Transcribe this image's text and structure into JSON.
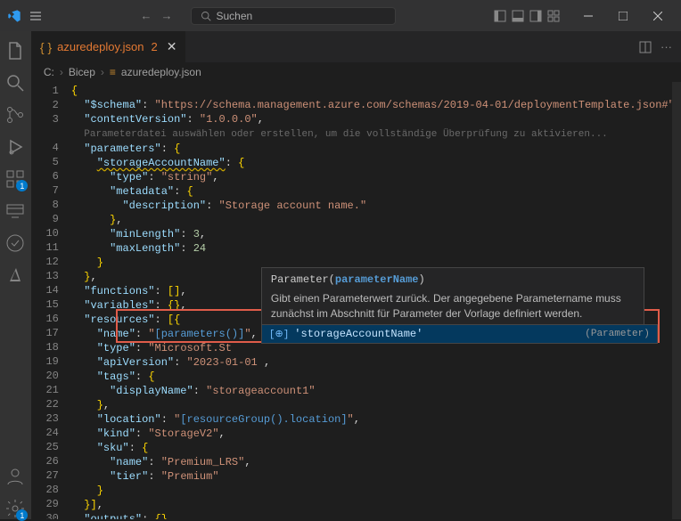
{
  "titlebar": {
    "search_placeholder": "Suchen"
  },
  "tab": {
    "name": "azuredeploy.json",
    "modified": "2"
  },
  "breadcrumb": {
    "folder": "C:",
    "sub": "Bicep",
    "file": "azuredeploy.json"
  },
  "activityBadges": {
    "extensions": "1",
    "settings": "1"
  },
  "tooltip": {
    "sig_prefix": "Parameter(",
    "sig_param": "parameterName",
    "sig_suffix": ")",
    "desc": "Gibt einen Parameterwert zurück. Der angegebene Parametername muss zunächst im Abschnitt für Parameter der Vorlage definiert werden."
  },
  "suggest": {
    "name": "'storageAccountName'",
    "kind": "(Parameter)"
  },
  "code": {
    "hint": "Parameterdatei auswählen oder erstellen, um die vollständige Überprüfung zu aktivieren...",
    "schema_key": "$schema",
    "schema_val": "https://schema.management.azure.com/schemas/2019-04-01/deploymentTemplate.json#",
    "contentVersion_key": "contentVersion",
    "contentVersion_val": "1.0.0.0",
    "parameters_key": "parameters",
    "storageAccountName_key": "storageAccountName",
    "type_key": "type",
    "type_val": "string",
    "metadata_key": "metadata",
    "description_key": "description",
    "description_val": "Storage account name.",
    "minLength_key": "minLength",
    "minLength_val": "3",
    "maxLength_key": "maxLength",
    "maxLength_val": "24",
    "functions_key": "functions",
    "variables_key": "variables",
    "resources_key": "resources",
    "name_key": "name",
    "name_expr": "[parameters()]",
    "res_type_key": "type",
    "res_type_val": "Microsoft.St",
    "apiVersion_key": "apiVersion",
    "apiVersion_val": "2023-01-01",
    "tags_key": "tags",
    "displayName_key": "displayName",
    "displayName_val": "storageaccount1",
    "location_key": "location",
    "location_val": "[resourceGroup().location]",
    "kind_key": "kind",
    "kind_val": "StorageV2",
    "sku_key": "sku",
    "sku_name_key": "name",
    "sku_name_val": "Premium_LRS",
    "sku_tier_key": "tier",
    "sku_tier_val": "Premium",
    "outputs_key": "outputs"
  },
  "lineNumbers": [
    "1",
    "2",
    "3",
    "",
    "4",
    "5",
    "6",
    "7",
    "8",
    "9",
    "10",
    "11",
    "12",
    "13",
    "14",
    "15",
    "16",
    "17",
    "18",
    "19",
    "20",
    "21",
    "22",
    "23",
    "24",
    "25",
    "26",
    "27",
    "28",
    "29",
    "30"
  ]
}
